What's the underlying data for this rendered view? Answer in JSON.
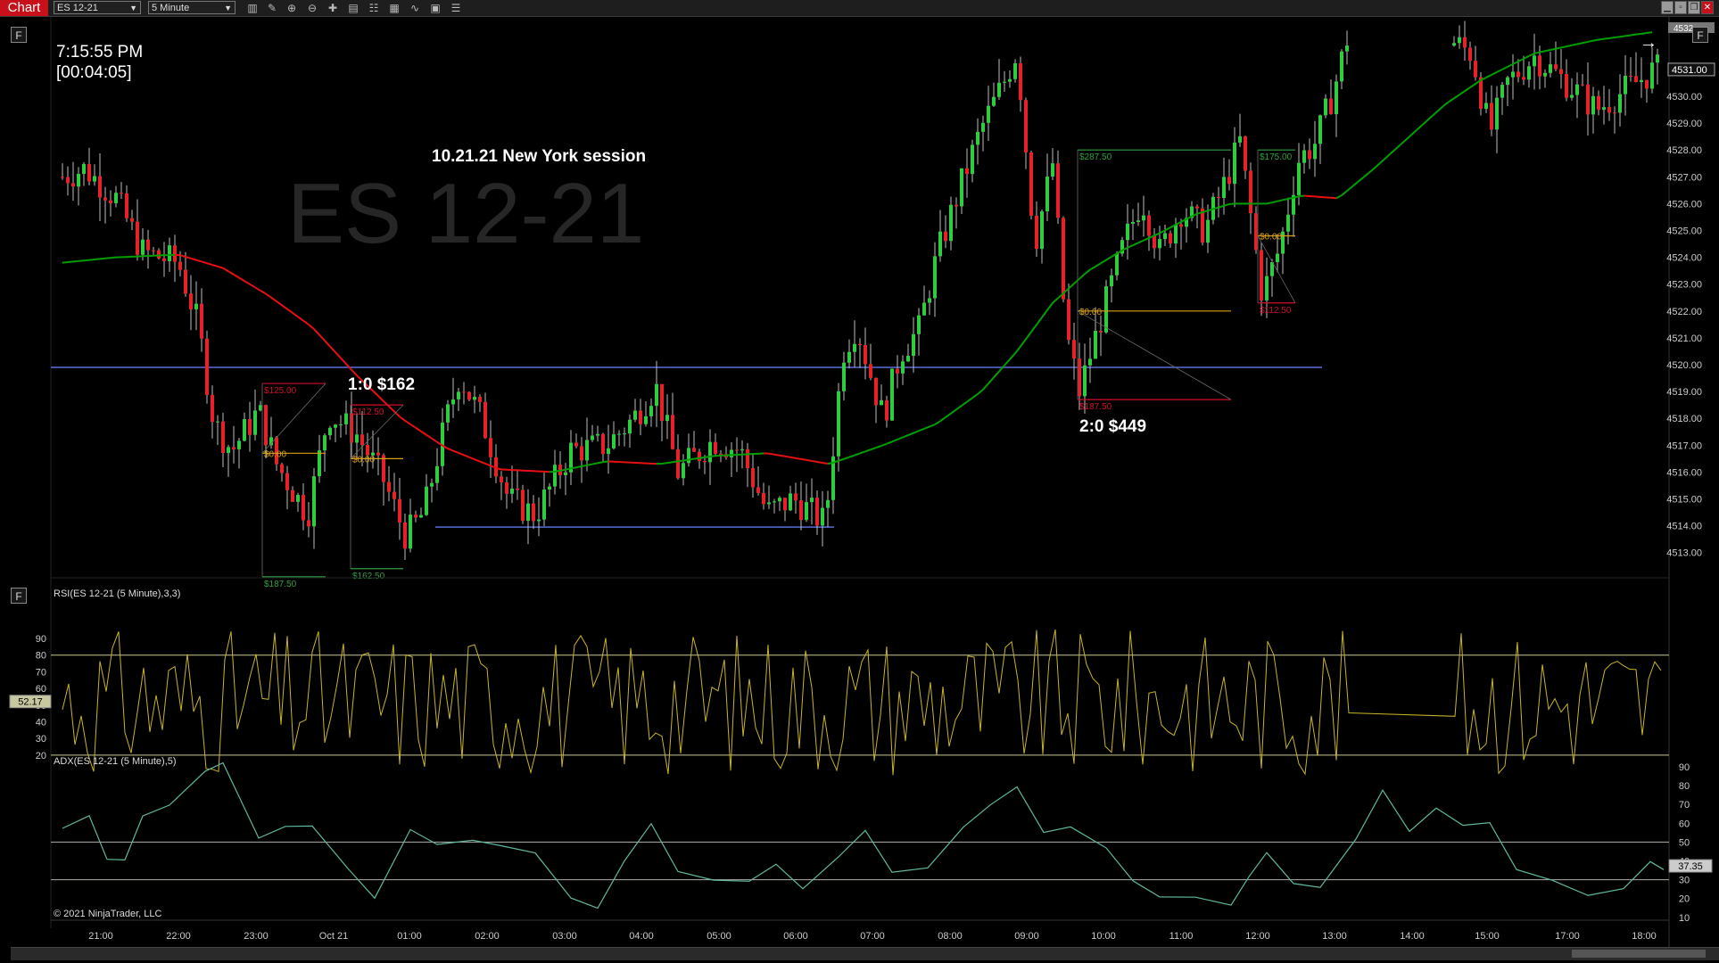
{
  "toolbar": {
    "tab_label": "Chart",
    "instrument": "ES 12-21",
    "interval": "5 Minute",
    "icons": [
      "bar-type-icon",
      "pencil-icon",
      "zoom-in-icon",
      "zoom-out-icon",
      "crosshair-icon",
      "data-box-icon",
      "template-icon",
      "chart-properties-icon",
      "strategy-icon",
      "indicator-icon",
      "properties-list-icon"
    ]
  },
  "price_panel": {
    "clock": "7:15:55 PM",
    "bar_timer": "[00:04:05]",
    "session_label": "10.21.21 New York session",
    "watermark": "ES 12-21",
    "panel_button": "F",
    "annotation_1": "1:0 $162",
    "annotation_2": "2:0 $449",
    "price_axis_labels": [
      "4530.00",
      "4529.00",
      "4528.00",
      "4527.00",
      "4526.00",
      "4525.00",
      "4524.00",
      "4523.00",
      "4522.00",
      "4521.00",
      "4520.00",
      "4519.00",
      "4518.00",
      "4517.00",
      "4516.00",
      "4515.00",
      "4514.00",
      "4513.00"
    ],
    "last_price": "4531.00",
    "top_price_fragment": "4532",
    "trade_labels": [
      "$125.00",
      "$0.00",
      "$187.50",
      "$112.50",
      "$0.00",
      "$162.50",
      "$287.50",
      "$0.00",
      "$187.50",
      "$175.00",
      "$0.00",
      "$112.50"
    ],
    "colors": {
      "up": "#2ecc40",
      "down": "#e8202a",
      "sma_up": "#00a000",
      "sma_down": "#e81010",
      "level": "#5a6ed8",
      "stop": "#d0102a",
      "target": "#2ea040",
      "entry": "#d8a010"
    }
  },
  "rsi_panel": {
    "title": "RSI(ES 12-21 (5 Minute),3,3)",
    "panel_button": "F",
    "current_value": "52.17",
    "axis_labels": [
      "90",
      "80",
      "70",
      "60",
      "50",
      "40",
      "30",
      "20"
    ],
    "color": "#c8b428"
  },
  "adx_panel": {
    "title": "ADX(ES 12-21 (5 Minute),5)",
    "current_value": "37.35",
    "axis_labels": [
      "90",
      "80",
      "70",
      "60",
      "50",
      "40",
      "30",
      "20",
      "10"
    ],
    "copyright": "© 2021 NinjaTrader, LLC",
    "color": "#5fb8a0"
  },
  "time_axis": {
    "labels": [
      "21:00",
      "22:00",
      "23:00",
      "Oct 21",
      "01:00",
      "02:00",
      "03:00",
      "04:00",
      "05:00",
      "06:00",
      "07:00",
      "08:00",
      "09:00",
      "10:00",
      "11:00",
      "12:00",
      "13:00",
      "14:00",
      "15:00",
      "17:00",
      "18:00"
    ]
  }
}
